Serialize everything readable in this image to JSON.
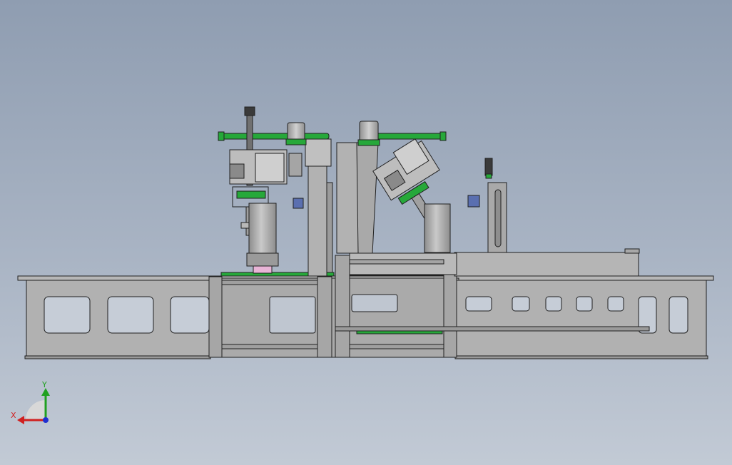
{
  "viewport": {
    "background_top": "#8f9db1",
    "background_bottom": "#c2cad5"
  },
  "colors": {
    "part_gray": "#b4b4b4",
    "part_dark": "#8a8a8a",
    "edge": "#202020",
    "accent_green": "#26a83a",
    "slider_blue": "#5a6fb0",
    "cup_pink": "#e8b4d6"
  },
  "triad": {
    "x_label": "X",
    "y_label": "Y",
    "x_color": "#d02020",
    "y_color": "#20a020",
    "z_color": "#2030d0"
  }
}
